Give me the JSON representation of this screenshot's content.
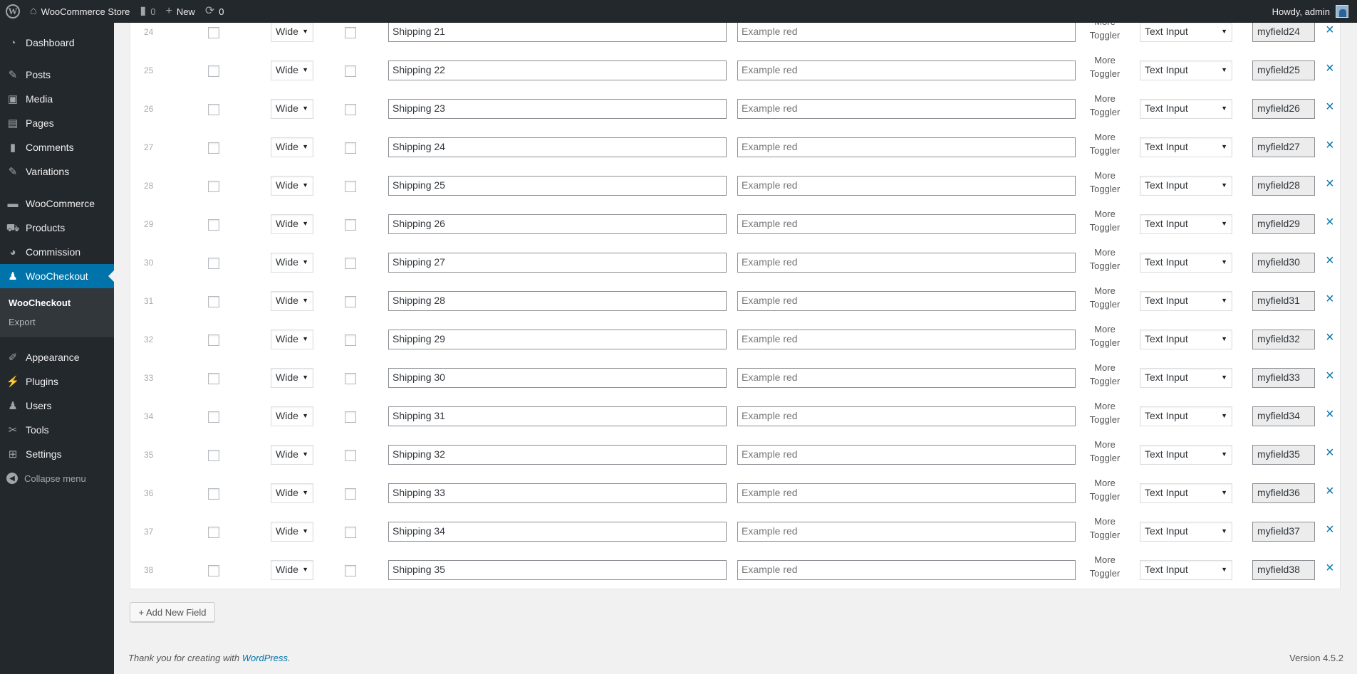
{
  "adminbar": {
    "site_name": "WooCommerce Store",
    "comments_count": "0",
    "new_label": "New",
    "updates_count": "0",
    "greeting": "Howdy, admin"
  },
  "sidebar": {
    "items": [
      {
        "label": "Dashboard",
        "icon": "dashboard-icon"
      },
      {
        "label": "Posts",
        "icon": "pin-icon"
      },
      {
        "label": "Media",
        "icon": "media-icon"
      },
      {
        "label": "Pages",
        "icon": "pages-icon"
      },
      {
        "label": "Comments",
        "icon": "comment-icon"
      },
      {
        "label": "Variations",
        "icon": "pin-icon"
      },
      {
        "label": "WooCommerce",
        "icon": "woo-icon"
      },
      {
        "label": "Products",
        "icon": "cart-icon"
      },
      {
        "label": "Commission",
        "icon": "pie-icon"
      },
      {
        "label": "WooCheckout",
        "icon": "user-icon"
      },
      {
        "label": "Appearance",
        "icon": "brush-icon"
      },
      {
        "label": "Plugins",
        "icon": "plug-icon"
      },
      {
        "label": "Users",
        "icon": "users-icon"
      },
      {
        "label": "Tools",
        "icon": "wrench-icon"
      },
      {
        "label": "Settings",
        "icon": "settings-icon"
      }
    ],
    "submenu": [
      "WooCheckout",
      "Export"
    ],
    "collapse_label": "Collapse menu"
  },
  "fields_table": {
    "rows": [
      {
        "num": "24",
        "width": "Wide",
        "label": "Shipping 21",
        "placeholder": "Example red",
        "more": "More Toggler",
        "type": "Text Input",
        "key": "myfield24"
      },
      {
        "num": "25",
        "width": "Wide",
        "label": "Shipping 22",
        "placeholder": "Example red",
        "more": "More Toggler",
        "type": "Text Input",
        "key": "myfield25"
      },
      {
        "num": "26",
        "width": "Wide",
        "label": "Shipping 23",
        "placeholder": "Example red",
        "more": "More Toggler",
        "type": "Text Input",
        "key": "myfield26"
      },
      {
        "num": "27",
        "width": "Wide",
        "label": "Shipping 24",
        "placeholder": "Example red",
        "more": "More Toggler",
        "type": "Text Input",
        "key": "myfield27"
      },
      {
        "num": "28",
        "width": "Wide",
        "label": "Shipping 25",
        "placeholder": "Example red",
        "more": "More Toggler",
        "type": "Text Input",
        "key": "myfield28"
      },
      {
        "num": "29",
        "width": "Wide",
        "label": "Shipping 26",
        "placeholder": "Example red",
        "more": "More Toggler",
        "type": "Text Input",
        "key": "myfield29"
      },
      {
        "num": "30",
        "width": "Wide",
        "label": "Shipping 27",
        "placeholder": "Example red",
        "more": "More Toggler",
        "type": "Text Input",
        "key": "myfield30"
      },
      {
        "num": "31",
        "width": "Wide",
        "label": "Shipping 28",
        "placeholder": "Example red",
        "more": "More Toggler",
        "type": "Text Input",
        "key": "myfield31"
      },
      {
        "num": "32",
        "width": "Wide",
        "label": "Shipping 29",
        "placeholder": "Example red",
        "more": "More Toggler",
        "type": "Text Input",
        "key": "myfield32"
      },
      {
        "num": "33",
        "width": "Wide",
        "label": "Shipping 30",
        "placeholder": "Example red",
        "more": "More Toggler",
        "type": "Text Input",
        "key": "myfield33"
      },
      {
        "num": "34",
        "width": "Wide",
        "label": "Shipping 31",
        "placeholder": "Example red",
        "more": "More Toggler",
        "type": "Text Input",
        "key": "myfield34"
      },
      {
        "num": "35",
        "width": "Wide",
        "label": "Shipping 32",
        "placeholder": "Example red",
        "more": "More Toggler",
        "type": "Text Input",
        "key": "myfield35"
      },
      {
        "num": "36",
        "width": "Wide",
        "label": "Shipping 33",
        "placeholder": "Example red",
        "more": "More Toggler",
        "type": "Text Input",
        "key": "myfield36"
      },
      {
        "num": "37",
        "width": "Wide",
        "label": "Shipping 34",
        "placeholder": "Example red",
        "more": "More Toggler",
        "type": "Text Input",
        "key": "myfield37"
      },
      {
        "num": "38",
        "width": "Wide",
        "label": "Shipping 35",
        "placeholder": "Example red",
        "more": "More Toggler",
        "type": "Text Input",
        "key": "myfield38"
      }
    ]
  },
  "add_button_label": "+ Add New Field",
  "footer": {
    "thanks_prefix": "Thank you for creating with ",
    "thanks_link": "WordPress",
    "thanks_suffix": ".",
    "version": "Version 4.5.2"
  },
  "colors": {
    "admin_dark": "#23282d",
    "accent_blue": "#0073aa",
    "background": "#f1f1f1"
  }
}
